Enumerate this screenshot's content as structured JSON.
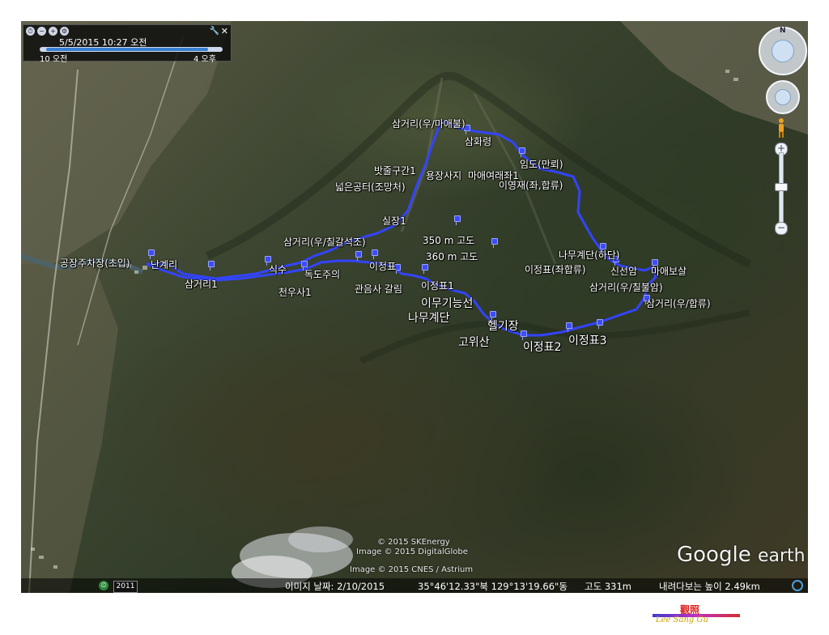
{
  "timebar": {
    "date_time": "5/5/2015  10:27 오전",
    "range_start": "10 오전",
    "range_end": "4 오후"
  },
  "navigation": {
    "compass_north": "N"
  },
  "zoom": {
    "plus": "+",
    "minus": "−"
  },
  "places": {
    "parking": "공장주차장(초입)",
    "nangyeoli": "난계리",
    "junction1": "삼거리1",
    "water": "식수",
    "poison": "독도주의",
    "cheonusa": "천우사1",
    "junction_cliff": "삼거리(우/칠갈석조)",
    "ridge1": "실장1",
    "wide_rock": "넓은공터(조망처)",
    "rocky_section": "밧줄구간1",
    "yongjangsa": "용장사지",
    "buddha_relief": "마애여래좌1",
    "top_junction": "삼거리(우/마애불)",
    "top_peak": "삼화령",
    "imdo": "임도(만뢰)",
    "yiyeongjae": "이영재(좌,합류)",
    "alt350": "350 m 고도",
    "alt360": "360 m 고도",
    "milestone": "이정표",
    "gwaneumsa": "관음사 갈림",
    "milestone1": "이정표1",
    "imu": "이무기능선",
    "stairs": "나무계단",
    "heli": "헬기장",
    "gowisan": "고위산",
    "milestone2": "이정표2",
    "milestone3": "이정표3",
    "stairs_lower": "나무계단(하단)",
    "milestone_left": "이정표(좌합류)",
    "sinseonam": "신선암",
    "maebosal": "마애보살",
    "junction_chilbul": "삼거리(우/칠불암)",
    "junction_merge": "삼거리(우/합류)"
  },
  "credits": {
    "line1": "© 2015 SKEnergy",
    "line2": "Image © 2015 DigitalGlobe",
    "line3": "Image © 2015 CNES / Astrium"
  },
  "logo": {
    "google": "Google",
    "earth": "earth"
  },
  "status": {
    "year": "2011",
    "image_date": "이미지 날짜: 2/10/2015",
    "coords": "35°46'12.33\"북 129°13'19.66\"동",
    "elevation": "고도    331m",
    "eye_alt": "내려다보는 높이    2.49km"
  },
  "signature": {
    "top": "觀照",
    "name": "Lee Sang Gu"
  },
  "colors": {
    "track": "#3344ff",
    "pin": "#3c4cff"
  }
}
